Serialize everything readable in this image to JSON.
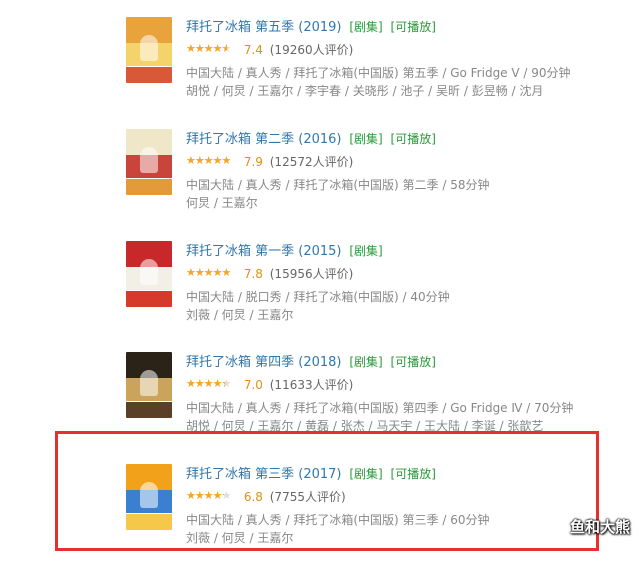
{
  "colors": {
    "title_link": "#3377aa",
    "tag_green": "#2a9a3a",
    "score_orange": "#e09015",
    "highlight_red": "#e53030"
  },
  "icons": {
    "rating": "star-icon"
  },
  "results": [
    {
      "title": "拜托了冰箱 第五季 (2019)",
      "tag_series": "[剧集]",
      "tag_playable": "[可播放]",
      "rating": 0.74,
      "score": "7.4",
      "votes": "(19260人评价)",
      "meta": "中国大陆 / 真人秀 / 拜托了冰箱(中国版) 第五季 / Go Fridge Ⅴ / 90分钟",
      "cast": "胡悦 / 何炅 / 王嘉尔 / 李宇春 / 关晓彤 / 池子 / 吴昕 / 彭昱畅 / 沈月",
      "poster_colors": [
        "#e8a33c",
        "#f4d36a",
        "#d9583a"
      ]
    },
    {
      "title": "拜托了冰箱 第二季 (2016)",
      "tag_series": "[剧集]",
      "tag_playable": "[可播放]",
      "rating": 0.79,
      "score": "7.9",
      "votes": "(12572人评价)",
      "meta": "中国大陆 / 真人秀 / 拜托了冰箱(中国版) 第二季 / 58分钟",
      "cast": "何炅 / 王嘉尔",
      "poster_colors": [
        "#f0e6c8",
        "#c9443a",
        "#e39a3b"
      ]
    },
    {
      "title": "拜托了冰箱 第一季 (2015)",
      "tag_series": "[剧集]",
      "tag_playable": "",
      "rating": 0.78,
      "score": "7.8",
      "votes": "(15956人评价)",
      "meta": "中国大陆 / 脱口秀 / 拜托了冰箱(中国版) / 40分钟",
      "cast": "刘薇 / 何炅 / 王嘉尔",
      "poster_colors": [
        "#c8282a",
        "#f2efe6",
        "#d63a2a"
      ]
    },
    {
      "title": "拜托了冰箱 第四季 (2018)",
      "tag_series": "[剧集]",
      "tag_playable": "[可播放]",
      "rating": 0.7,
      "score": "7.0",
      "votes": "(11633人评价)",
      "meta": "中国大陆 / 真人秀 / 拜托了冰箱(中国版) 第四季 / Go Fridge Ⅳ / 70分钟",
      "cast": "胡悦 / 何炅 / 王嘉尔 / 黄磊 / 张杰 / 马天宇 / 王大陆 / 李诞 / 张歆艺",
      "poster_colors": [
        "#2b2218",
        "#c9a45a",
        "#5a4026"
      ]
    },
    {
      "title": "拜托了冰箱 第三季 (2017)",
      "tag_series": "[剧集]",
      "tag_playable": "[可播放]",
      "rating": 0.68,
      "score": "6.8",
      "votes": "(7755人评价)",
      "meta": "中国大陆 / 真人秀 / 拜托了冰箱(中国版) 第三季 / 60分钟",
      "cast": "刘薇 / 何炅 / 王嘉尔",
      "poster_colors": [
        "#f2a21a",
        "#3a7fd0",
        "#f6c84a"
      ]
    }
  ],
  "watermark": "鱼和大熊"
}
